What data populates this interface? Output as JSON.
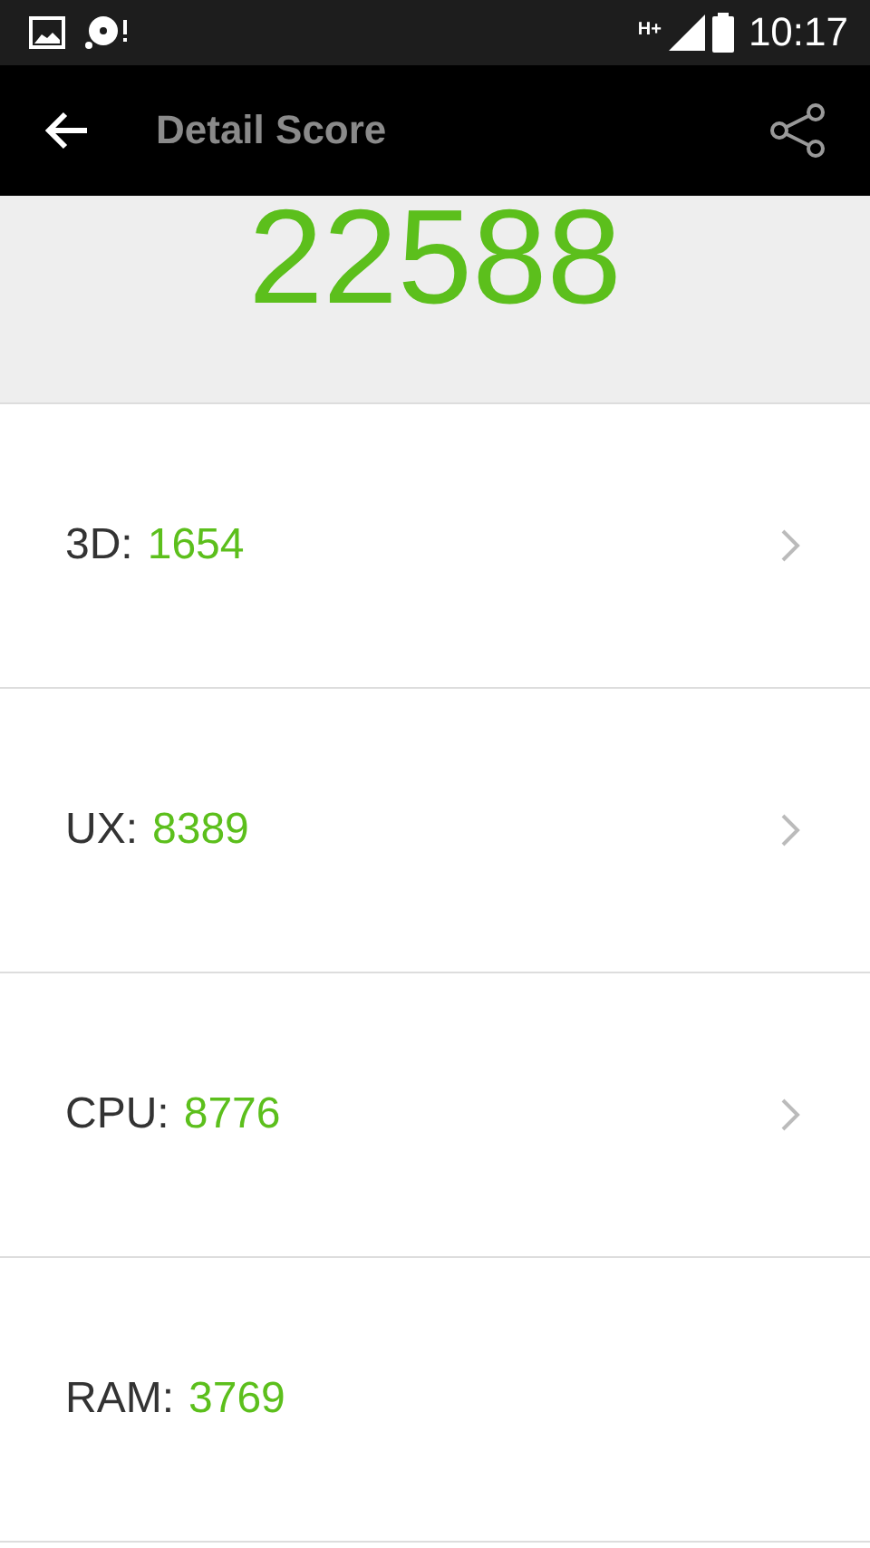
{
  "status_bar": {
    "network": "H+",
    "time": "10:17"
  },
  "app_bar": {
    "title": "Detail Score"
  },
  "total_score": "22588",
  "scores": [
    {
      "label": "3D:",
      "value": "1654",
      "expandable": true
    },
    {
      "label": "UX:",
      "value": "8389",
      "expandable": true
    },
    {
      "label": "CPU:",
      "value": "8776",
      "expandable": true
    },
    {
      "label": "RAM:",
      "value": "3769",
      "expandable": false
    }
  ]
}
